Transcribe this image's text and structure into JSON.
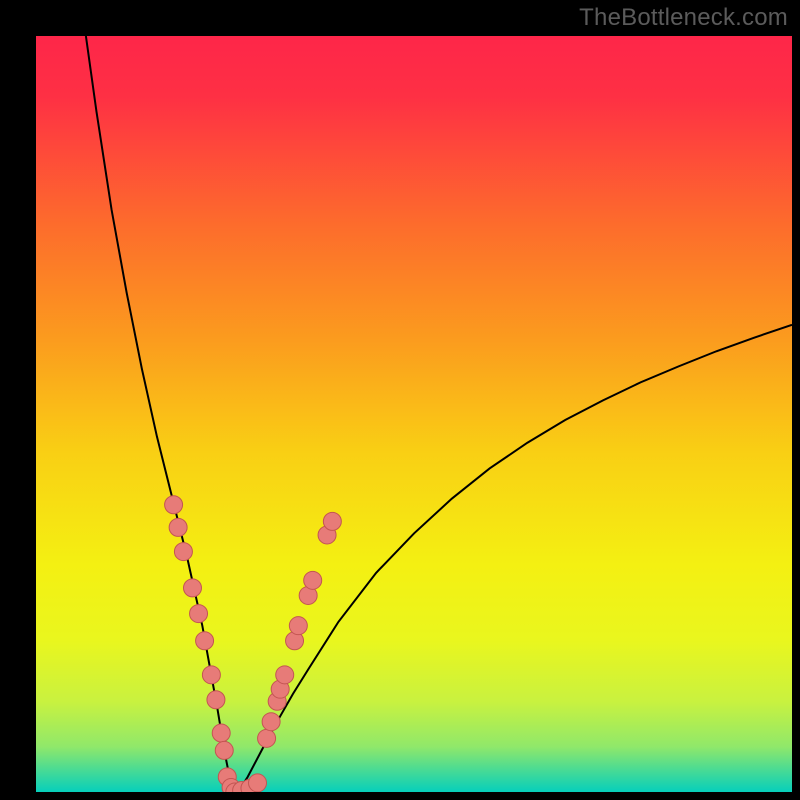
{
  "watermark": "TheBottleneck.com",
  "chart_data": {
    "type": "line",
    "title": "",
    "xlabel": "",
    "ylabel": "",
    "x_range": [
      0,
      1
    ],
    "y_range": [
      0,
      1
    ],
    "notch_x": 0.265,
    "curve_description": "Asymmetric V-shaped curve reaching zero at x≈0.265; steep descent on left from y≈1 at x≈0.07, slower rise on right to y≈0.62 at x=1.",
    "series": [
      {
        "name": "bottleneck-curve",
        "x": [
          0.066,
          0.08,
          0.1,
          0.12,
          0.14,
          0.16,
          0.18,
          0.2,
          0.22,
          0.24,
          0.25,
          0.255,
          0.26,
          0.265,
          0.27,
          0.275,
          0.28,
          0.3,
          0.32,
          0.34,
          0.36,
          0.4,
          0.45,
          0.5,
          0.55,
          0.6,
          0.65,
          0.7,
          0.75,
          0.8,
          0.85,
          0.9,
          0.95,
          1.0
        ],
        "y": [
          1.0,
          0.9,
          0.77,
          0.66,
          0.56,
          0.47,
          0.39,
          0.31,
          0.22,
          0.11,
          0.05,
          0.025,
          0.008,
          0.0,
          0.005,
          0.012,
          0.02,
          0.058,
          0.095,
          0.13,
          0.162,
          0.225,
          0.29,
          0.342,
          0.388,
          0.428,
          0.462,
          0.492,
          0.518,
          0.542,
          0.563,
          0.583,
          0.601,
          0.618
        ]
      }
    ],
    "markers": [
      {
        "x": 0.182,
        "y": 0.38,
        "r": 9
      },
      {
        "x": 0.188,
        "y": 0.35,
        "r": 9
      },
      {
        "x": 0.195,
        "y": 0.318,
        "r": 9
      },
      {
        "x": 0.207,
        "y": 0.27,
        "r": 9
      },
      {
        "x": 0.215,
        "y": 0.236,
        "r": 9
      },
      {
        "x": 0.223,
        "y": 0.2,
        "r": 9
      },
      {
        "x": 0.232,
        "y": 0.155,
        "r": 9
      },
      {
        "x": 0.238,
        "y": 0.122,
        "r": 9
      },
      {
        "x": 0.245,
        "y": 0.078,
        "r": 9
      },
      {
        "x": 0.249,
        "y": 0.055,
        "r": 9
      },
      {
        "x": 0.253,
        "y": 0.02,
        "r": 9
      },
      {
        "x": 0.258,
        "y": 0.006,
        "r": 9
      },
      {
        "x": 0.263,
        "y": 0.0,
        "r": 9
      },
      {
        "x": 0.272,
        "y": 0.002,
        "r": 9
      },
      {
        "x": 0.283,
        "y": 0.005,
        "r": 9
      },
      {
        "x": 0.293,
        "y": 0.012,
        "r": 9
      },
      {
        "x": 0.305,
        "y": 0.071,
        "r": 9
      },
      {
        "x": 0.311,
        "y": 0.093,
        "r": 9
      },
      {
        "x": 0.319,
        "y": 0.12,
        "r": 9
      },
      {
        "x": 0.323,
        "y": 0.136,
        "r": 9
      },
      {
        "x": 0.329,
        "y": 0.155,
        "r": 9
      },
      {
        "x": 0.342,
        "y": 0.2,
        "r": 9
      },
      {
        "x": 0.347,
        "y": 0.22,
        "r": 9
      },
      {
        "x": 0.36,
        "y": 0.26,
        "r": 9
      },
      {
        "x": 0.366,
        "y": 0.28,
        "r": 9
      },
      {
        "x": 0.385,
        "y": 0.34,
        "r": 9
      },
      {
        "x": 0.392,
        "y": 0.358,
        "r": 9
      }
    ],
    "background": {
      "type": "vertical-gradient",
      "stops": [
        {
          "offset": 0.0,
          "color": "#fe2649"
        },
        {
          "offset": 0.08,
          "color": "#fe3044"
        },
        {
          "offset": 0.25,
          "color": "#fd6c2c"
        },
        {
          "offset": 0.4,
          "color": "#fb9b1e"
        },
        {
          "offset": 0.55,
          "color": "#f9cf14"
        },
        {
          "offset": 0.7,
          "color": "#f4f012"
        },
        {
          "offset": 0.8,
          "color": "#e9f61e"
        },
        {
          "offset": 0.88,
          "color": "#c9f23f"
        },
        {
          "offset": 0.94,
          "color": "#90e86a"
        },
        {
          "offset": 0.975,
          "color": "#3fd99a"
        },
        {
          "offset": 1.0,
          "color": "#06cfbb"
        }
      ]
    },
    "marker_style": {
      "fill": "#e77b78",
      "stroke": "#c35552"
    },
    "curve_color": "#000000"
  }
}
